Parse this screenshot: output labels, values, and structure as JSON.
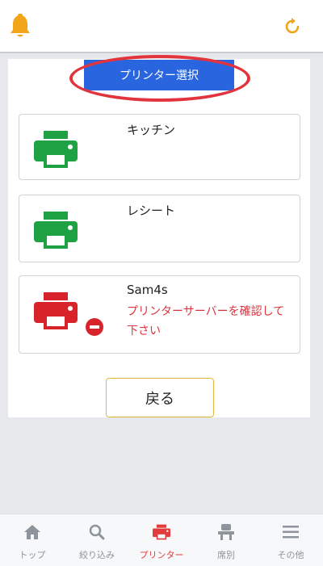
{
  "colors": {
    "accent": "#2a65e0",
    "bell": "#f2a51a",
    "ok": "#1fa244",
    "error": "#d8343c",
    "highlight": "#e2343c",
    "tab_active": "#e23c3c",
    "tab_inactive": "#8d949c"
  },
  "header": {
    "left_icon": "bell-icon",
    "right_icon": "refresh-icon"
  },
  "main": {
    "select_label": "プリンター選択",
    "printers": [
      {
        "name": "キッチン",
        "status": "ok",
        "icon": "printer-icon"
      },
      {
        "name": "レシート",
        "status": "ok",
        "icon": "printer-icon"
      },
      {
        "name": "Sam4s",
        "status": "error",
        "icon": "printer-icon",
        "message": "プリンターサーバーを確認して下さい"
      }
    ],
    "back_label": "戻る"
  },
  "tabbar": {
    "active": "printer",
    "items": [
      {
        "label": "トップ",
        "icon": "home-icon"
      },
      {
        "label": "絞り込み",
        "icon": "search-icon"
      },
      {
        "label": "プリンター",
        "icon": "printer-icon"
      },
      {
        "label": "席別",
        "icon": "seat-icon"
      },
      {
        "label": "その他",
        "icon": "menu-icon"
      }
    ]
  }
}
